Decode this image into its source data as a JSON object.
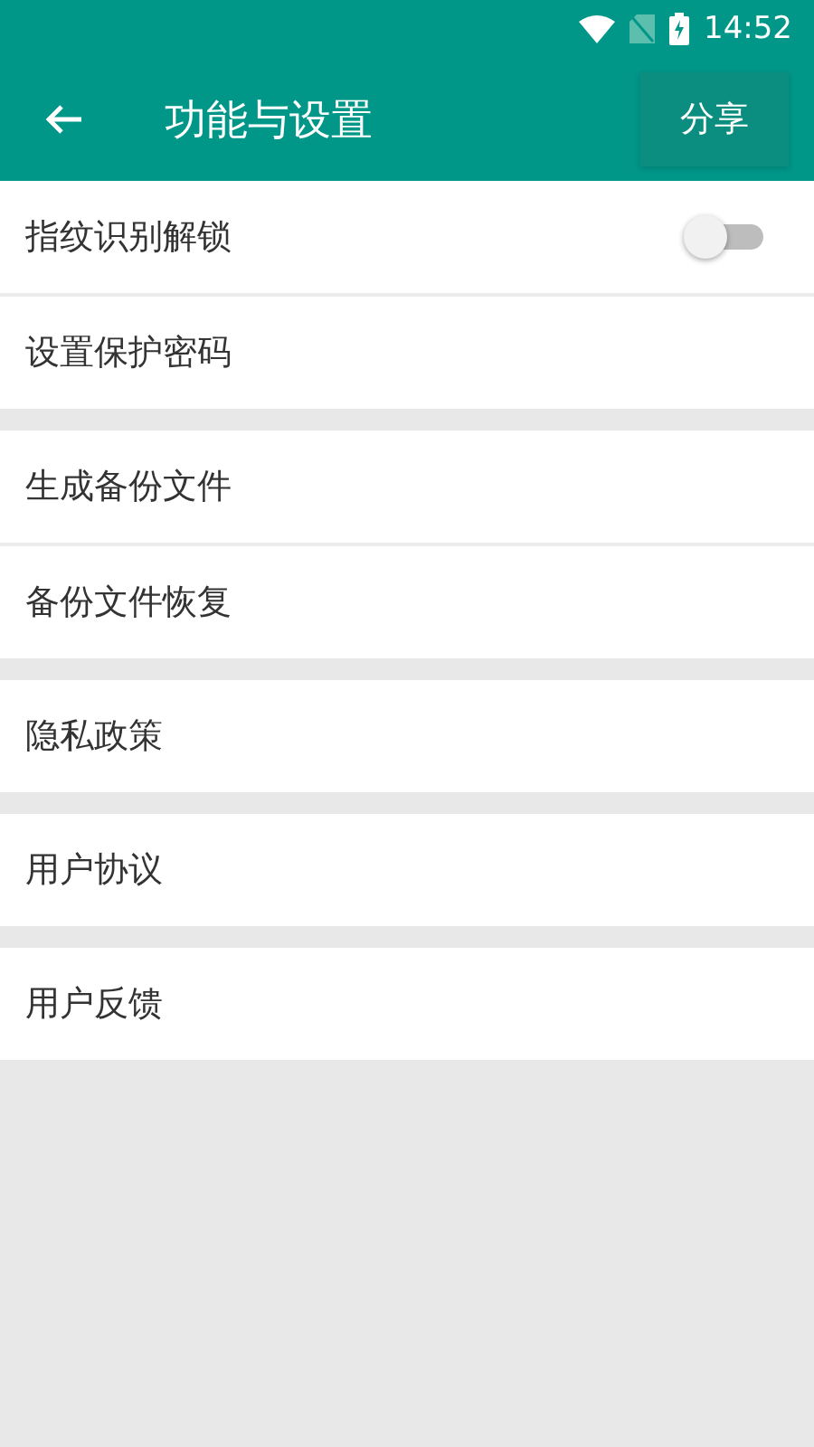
{
  "status_bar": {
    "time": "14:52"
  },
  "toolbar": {
    "title": "功能与设置",
    "action": "分享"
  },
  "groups": [
    {
      "items": [
        {
          "label": "指纹识别解锁",
          "kind": "switch",
          "on": false
        },
        {
          "label": "设置保护密码",
          "kind": "plain"
        }
      ]
    },
    {
      "items": [
        {
          "label": "生成备份文件",
          "kind": "plain"
        },
        {
          "label": "备份文件恢复",
          "kind": "plain"
        }
      ]
    },
    {
      "items": [
        {
          "label": "隐私政策",
          "kind": "plain"
        }
      ]
    },
    {
      "items": [
        {
          "label": "用户协议",
          "kind": "plain"
        }
      ]
    },
    {
      "items": [
        {
          "label": "用户反馈",
          "kind": "plain"
        }
      ]
    }
  ]
}
